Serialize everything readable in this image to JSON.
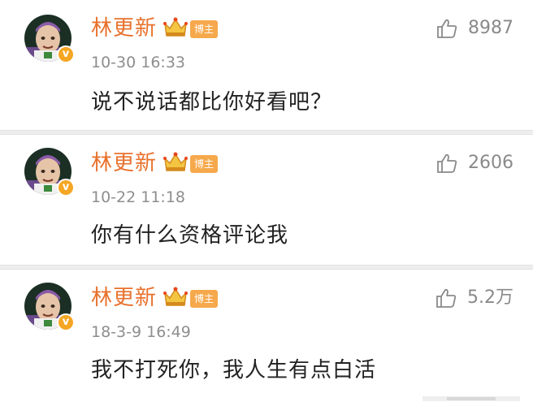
{
  "colors": {
    "username": "#e8712c",
    "badge": "#f6a94c",
    "verified": "#f5a623",
    "timestamp": "#8e8e8e",
    "content": "#222222",
    "divider": "#eeeeee"
  },
  "comments": [
    {
      "username": "林更新",
      "badge_label": "博主",
      "verified_mark": "v",
      "timestamp": "10-30 16:33",
      "content": "说不说话都比你好看吧？",
      "likes": "8987",
      "like_icon": "thumbs-up-icon"
    },
    {
      "username": "林更新",
      "badge_label": "博主",
      "verified_mark": "v",
      "timestamp": "10-22 11:18",
      "content": "你有什么资格评论我",
      "likes": "2606",
      "like_icon": "thumbs-up-icon"
    },
    {
      "username": "林更新",
      "badge_label": "博主",
      "verified_mark": "v",
      "timestamp": "18-3-9 16:49",
      "content": "我不打死你，我人生有点白活",
      "likes": "5.2万",
      "like_icon": "thumbs-up-icon"
    }
  ]
}
